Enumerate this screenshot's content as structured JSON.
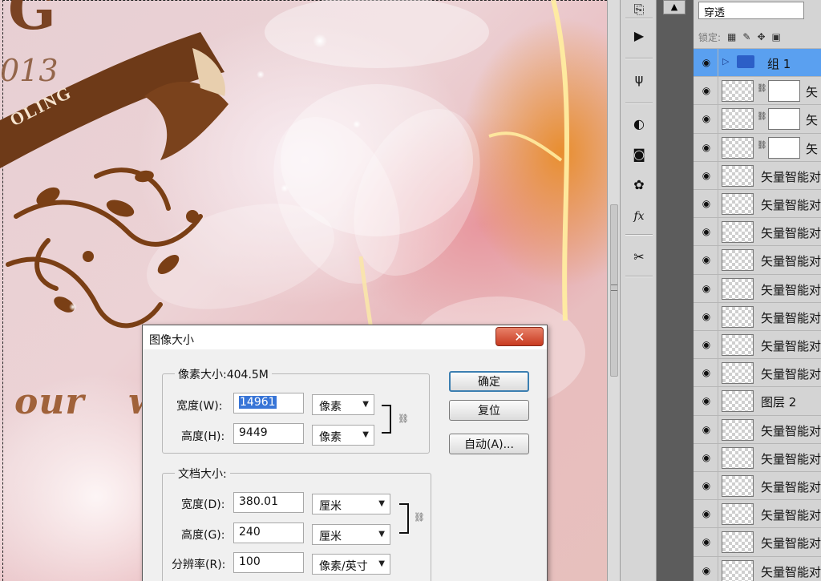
{
  "canvas": {
    "big_letter": "G",
    "year_text": "013",
    "ribbon_text": "OLING",
    "script_text": "our",
    "script_text2": "w"
  },
  "toolbar": {
    "tools": [
      "history-icon",
      "actions-play-icon",
      "usb-icon",
      "brush-icon",
      "mask-icon",
      "styles-icon",
      "fx-icon",
      "tools-icon"
    ],
    "mini_tool_label": "▲"
  },
  "layers": {
    "blend_mode": "穿透",
    "lock_label": "锁定:",
    "rows": [
      {
        "name": "组 1",
        "type": "group",
        "selected": true
      },
      {
        "name": "矢",
        "type": "masked"
      },
      {
        "name": "矢",
        "type": "masked"
      },
      {
        "name": "矢",
        "type": "masked"
      },
      {
        "name": "矢量智能对",
        "type": "layer"
      },
      {
        "name": "矢量智能对",
        "type": "layer"
      },
      {
        "name": "矢量智能对",
        "type": "layer"
      },
      {
        "name": "矢量智能对",
        "type": "layer"
      },
      {
        "name": "矢量智能对",
        "type": "layer"
      },
      {
        "name": "矢量智能对",
        "type": "layer"
      },
      {
        "name": "矢量智能对",
        "type": "layer"
      },
      {
        "name": "矢量智能对",
        "type": "layer"
      },
      {
        "name": "图层 2",
        "type": "layer"
      },
      {
        "name": "矢量智能对",
        "type": "layer"
      },
      {
        "name": "矢量智能对",
        "type": "layer"
      },
      {
        "name": "矢量智能对",
        "type": "layer"
      },
      {
        "name": "矢量智能对",
        "type": "layer"
      },
      {
        "name": "矢量智能对",
        "type": "layer"
      },
      {
        "name": "矢量智能对",
        "type": "layer"
      }
    ]
  },
  "dialog": {
    "title": "图像大小",
    "close_label": "✕",
    "pixel_dimensions_label": "像素大小:404.5M",
    "width_label": "宽度(W):",
    "width_value": "14961",
    "width_unit": "像素",
    "height_label": "高度(H):",
    "height_value": "9449",
    "height_unit": "像素",
    "document_size_label": "文档大小:",
    "doc_width_label": "宽度(D):",
    "doc_width_value": "380.01",
    "doc_width_unit": "厘米",
    "doc_height_label": "高度(G):",
    "doc_height_value": "240",
    "doc_height_unit": "厘米",
    "resolution_label": "分辨率(R):",
    "resolution_value": "100",
    "resolution_unit": "像素/英寸",
    "ok_label": "确定",
    "reset_label": "复位",
    "auto_label": "自动(A)..."
  }
}
